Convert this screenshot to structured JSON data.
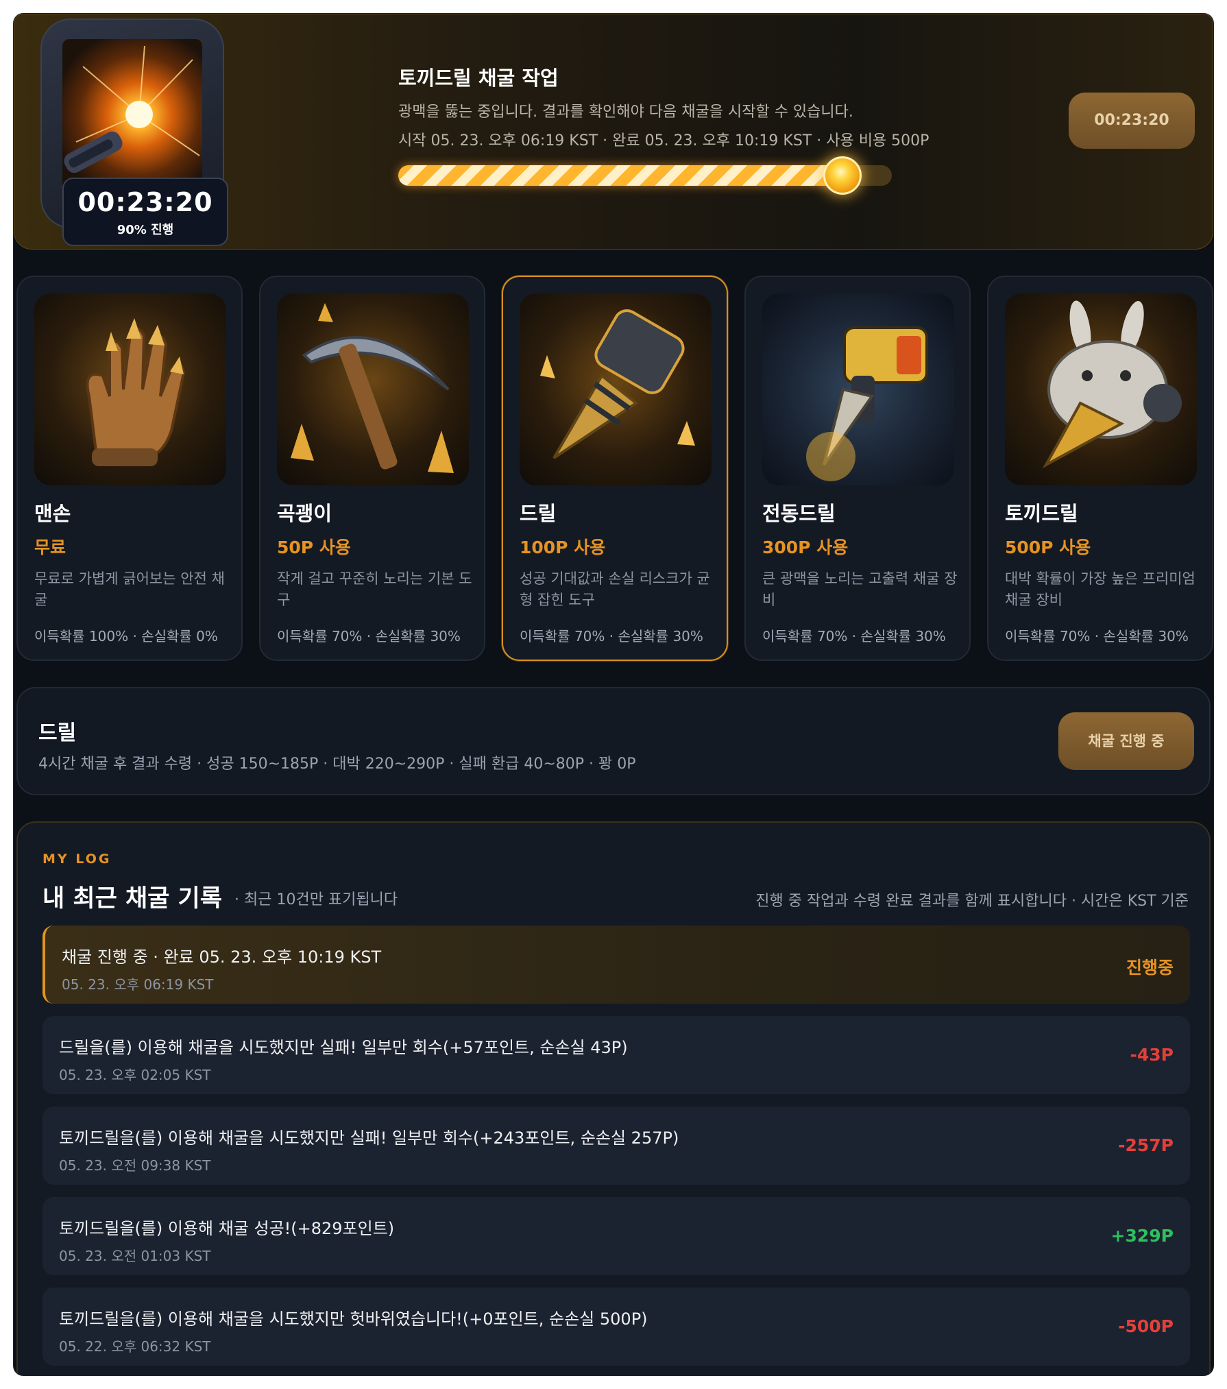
{
  "hero": {
    "title": "토끼드릴 채굴 작업",
    "description": "광맥을 뚫는 중입니다. 결과를 확인해야 다음 채굴을 시작할 수 있습니다.",
    "meta": "시작 05. 23. 오후 06:19 KST · 완료 05. 23. 오후 10:19 KST · 사용 비용 500P",
    "timer": "00:23:20",
    "progress_label": "90% 진행",
    "progress_fraction": 0.9,
    "button_label": "00:23:20"
  },
  "tools": [
    {
      "name": "맨손",
      "cost": "무료",
      "description": "무료로 가볍게 긁어보는 안전 채굴",
      "probability": "이득확률 100% · 손실확률 0%",
      "icon": "glove-icon"
    },
    {
      "name": "곡괭이",
      "cost": "50P 사용",
      "description": "작게 걸고 꾸준히 노리는 기본 도구",
      "probability": "이득확률 70% · 손실확률 30%",
      "icon": "pickaxe-icon"
    },
    {
      "name": "드릴",
      "cost": "100P 사용",
      "description": "성공 기대값과 손실 리스크가 균형 잡힌 도구",
      "probability": "이득확률 70% · 손실확률 30%",
      "icon": "drill-icon"
    },
    {
      "name": "전동드릴",
      "cost": "300P 사용",
      "description": "큰 광맥을 노리는 고출력 채굴 장비",
      "probability": "이득확률 70% · 손실확률 30%",
      "icon": "power-drill-icon"
    },
    {
      "name": "토끼드릴",
      "cost": "500P 사용",
      "description": "대박 확률이 가장 높은 프리미엄 채굴 장비",
      "probability": "이득확률 70% · 손실확률 30%",
      "icon": "rabbit-drill-icon"
    }
  ],
  "selected_tool": {
    "name": "드릴",
    "detail": "4시간 채굴 후 결과 수령 · 성공 150~185P · 대박 220~290P · 실패 환급 40~80P · 꽝 0P",
    "button_label": "채굴 진행 중"
  },
  "log": {
    "kicker": "MY LOG",
    "title": "내 최근 채굴 기록",
    "note": "· 최근 10건만 표기됩니다",
    "right_note": "진행 중 작업과 수령 완료 결과를 함께 표시합니다 · 시간은 KST 기준",
    "entries": [
      {
        "text": "채굴 진행 중 · 완료 05. 23. 오후 10:19 KST",
        "time": "05. 23. 오후 06:19 KST",
        "value": "진행중",
        "status": "progress"
      },
      {
        "text": "드릴을(를) 이용해 채굴을 시도했지만 실패! 일부만 회수(+57포인트, 순손실 43P)",
        "time": "05. 23. 오후 02:05 KST",
        "value": "-43P",
        "status": "loss"
      },
      {
        "text": "토끼드릴을(를) 이용해 채굴을 시도했지만 실패! 일부만 회수(+243포인트, 순손실 257P)",
        "time": "05. 23. 오전 09:38 KST",
        "value": "-257P",
        "status": "loss"
      },
      {
        "text": "토끼드릴을(를) 이용해 채굴 성공!(+829포인트)",
        "time": "05. 23. 오전 01:03 KST",
        "value": "+329P",
        "status": "gain"
      },
      {
        "text": "토끼드릴을(를) 이용해 채굴을 시도했지만 헛바위였습니다!(+0포인트, 순손실 500P)",
        "time": "05. 22. 오후 06:32 KST",
        "value": "-500P",
        "status": "loss"
      }
    ]
  },
  "colors": {
    "accent": "#e69322",
    "loss": "#e4403a",
    "gain": "#2fc05e",
    "background": "#0c1017"
  }
}
